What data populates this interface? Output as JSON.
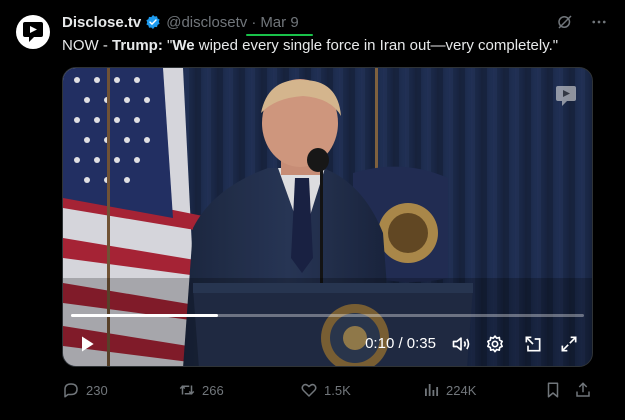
{
  "account": {
    "name": "Disclose.tv",
    "handle": "@disclosetv",
    "separator": "·",
    "date": "Mar 9"
  },
  "tweet": {
    "prefix": "NOW - ",
    "speaker": "Trump:",
    "quote_open": " \"",
    "quote_bold": "We",
    "quote_rest": " wiped every single force in Iran out—very completely.\""
  },
  "video": {
    "time": "0:10 / 0:35",
    "progress": 0.286
  },
  "metrics": {
    "replies": "230",
    "reposts": "266",
    "likes": "1.5K",
    "views": "224K"
  },
  "colors": {
    "background": "#000000",
    "text": "#e7e9ea",
    "muted": "#71767b",
    "verified": "#1d9bf0",
    "highlight": "#19c24a"
  },
  "icons": {
    "avatar": "disclose-logo-icon",
    "verified": "verified-badge-icon",
    "grok": "grok-icon",
    "more": "more-icon",
    "play": "play-icon",
    "volume": "volume-icon",
    "settings": "gear-icon",
    "pip": "picture-in-picture-icon",
    "fullscreen": "fullscreen-icon",
    "reply": "reply-icon",
    "repost": "repost-icon",
    "like": "heart-icon",
    "views": "views-icon",
    "bookmark": "bookmark-icon",
    "share": "share-icon"
  }
}
